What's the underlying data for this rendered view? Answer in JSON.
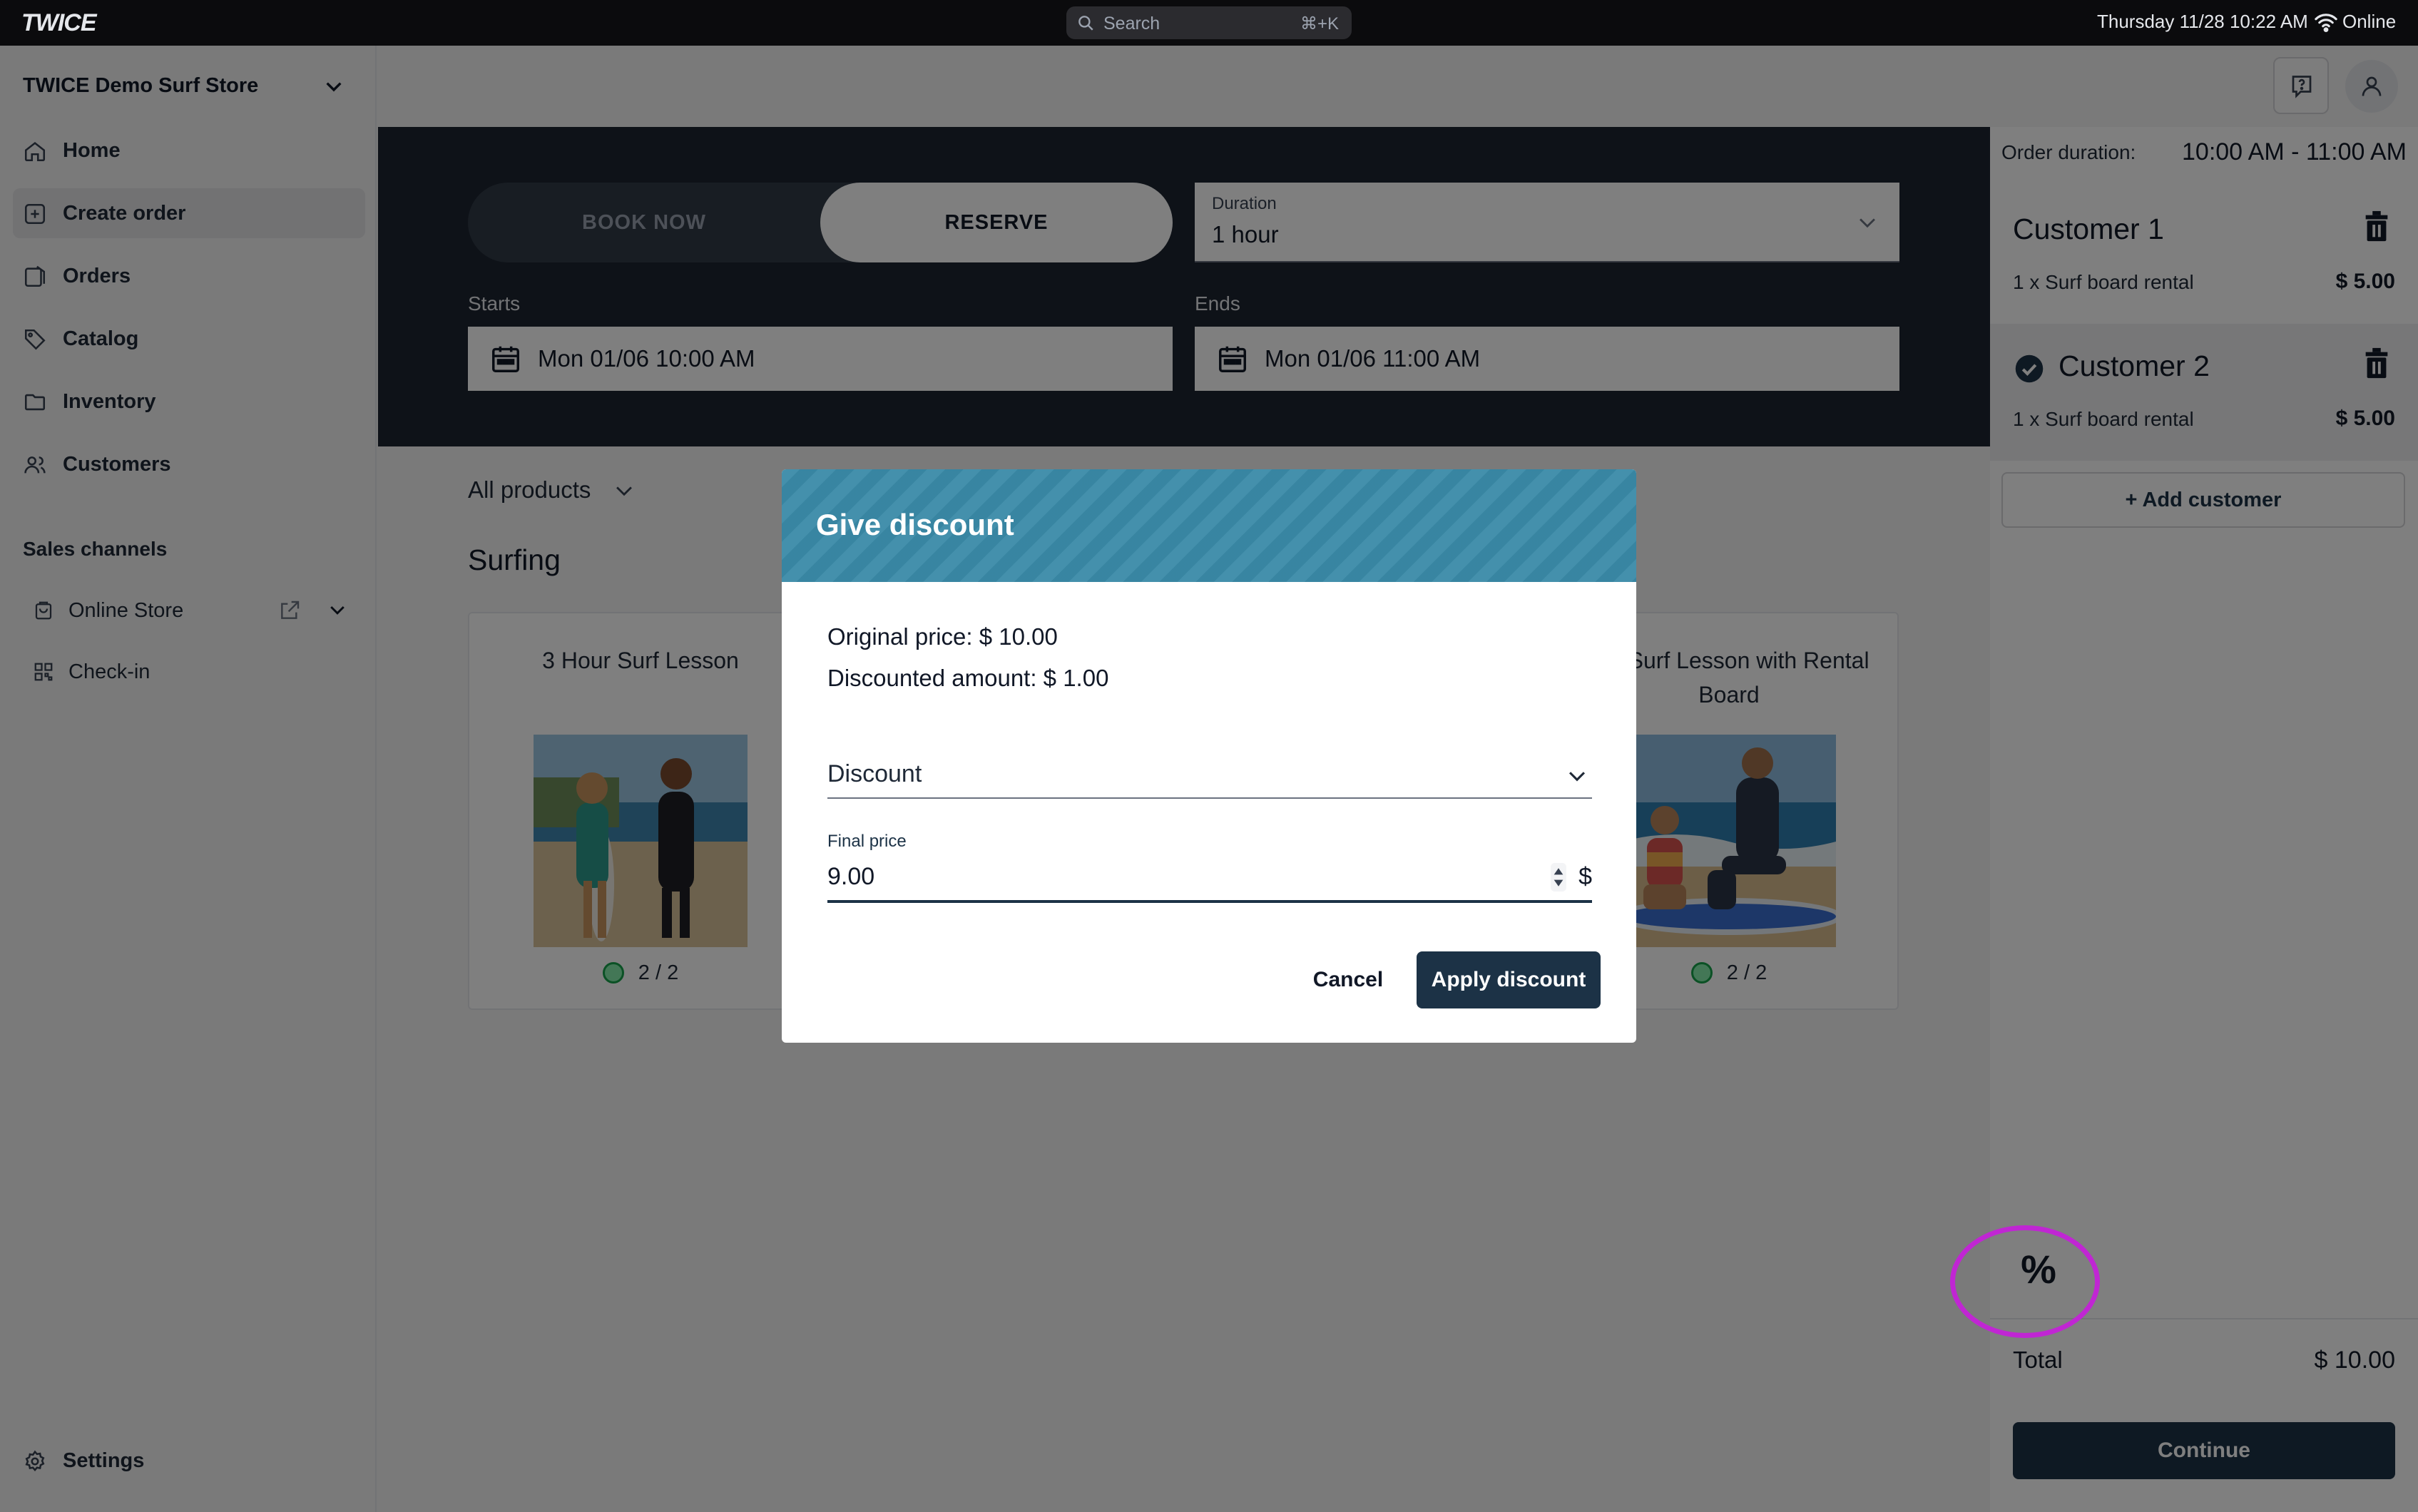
{
  "system_bar": {
    "logo": "TWICE",
    "search_placeholder": "Search",
    "search_shortcut": "⌘+K",
    "datetime": "Thursday 11/28 10:22 AM",
    "status": "Online"
  },
  "sidebar": {
    "store_name": "TWICE Demo Surf Store",
    "items": [
      {
        "label": "Home",
        "icon": "home-icon"
      },
      {
        "label": "Create order",
        "icon": "plus-square-icon",
        "active": true
      },
      {
        "label": "Orders",
        "icon": "orders-icon"
      },
      {
        "label": "Catalog",
        "icon": "tag-icon"
      },
      {
        "label": "Inventory",
        "icon": "folder-icon"
      },
      {
        "label": "Customers",
        "icon": "users-icon"
      }
    ],
    "sales_channels_title": "Sales channels",
    "channels": [
      {
        "label": "Online Store",
        "icon": "store-icon"
      },
      {
        "label": "Check-in",
        "icon": "qr-code-icon"
      }
    ],
    "settings_label": "Settings"
  },
  "booking": {
    "mode_options": [
      "BOOK NOW",
      "RESERVE"
    ],
    "selected_mode": "RESERVE",
    "duration_label": "Duration",
    "duration_value": "1 hour",
    "starts_label": "Starts",
    "starts_value": "Mon 01/06 10:00 AM",
    "ends_label": "Ends",
    "ends_value": "Mon 01/06 11:00 AM"
  },
  "products": {
    "filter_label": "All products",
    "section_title": "Surfing",
    "cards": [
      {
        "title": "3 Hour Surf Lesson",
        "stock": "2 / 2"
      },
      {
        "title": "our Surf Lesson with Rental Board",
        "stock": "2 / 2"
      }
    ]
  },
  "cart": {
    "order_duration_label": "Order duration:",
    "order_duration_value": "10:00 AM - 11:00 AM",
    "customers": [
      {
        "name": "Customer 1",
        "line": "1 x Surf board rental",
        "price": "$ 5.00",
        "selected": false
      },
      {
        "name": "Customer 2",
        "line": "1 x Surf board rental",
        "price": "$ 5.00",
        "selected": true
      }
    ],
    "add_customer_label": "+ Add customer",
    "discount_symbol": "%",
    "total_label": "Total",
    "total_value": "$ 10.00",
    "continue_label": "Continue"
  },
  "dialog": {
    "title": "Give discount",
    "original_price": "Original price: $ 10.00",
    "discounted_amount": "Discounted amount: $ 1.00",
    "discount_select_value": "Discount",
    "final_price_label": "Final price",
    "final_price_value": "9.00",
    "currency": "$",
    "cancel_label": "Cancel",
    "apply_label": "Apply discount"
  },
  "colors": {
    "accent": "#1c3246",
    "dialog_header": "#3a8aa8",
    "highlight": "#c026d3",
    "stock_dot": "#86efac"
  }
}
